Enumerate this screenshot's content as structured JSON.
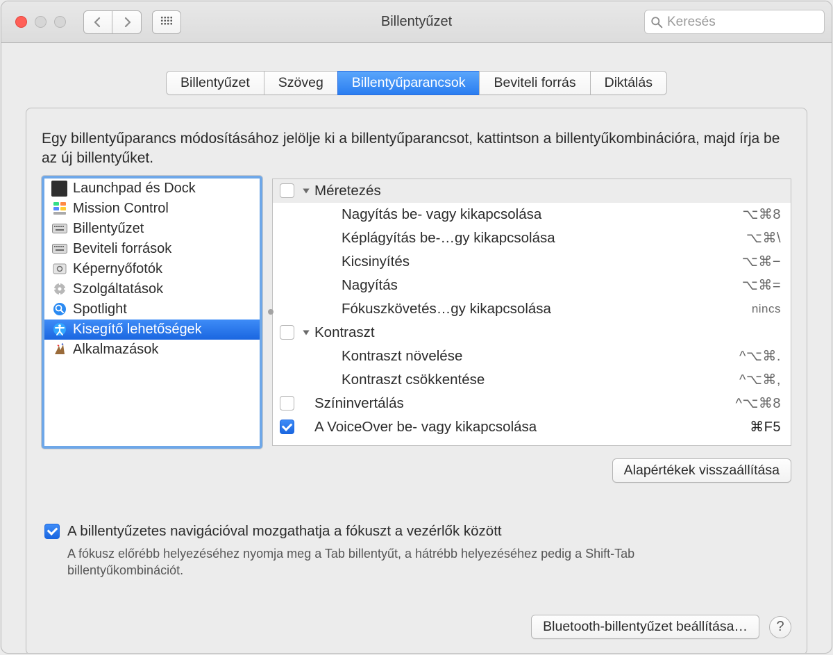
{
  "window_title": "Billentyűzet",
  "search": {
    "placeholder": "Keresés"
  },
  "tabs": [
    {
      "label": "Billentyűzet"
    },
    {
      "label": "Szöveg"
    },
    {
      "label": "Billentyűparancsok"
    },
    {
      "label": "Beviteli forrás"
    },
    {
      "label": "Diktálás"
    }
  ],
  "instruction": "Egy billentyűparancs módosításához jelölje ki a billentyűparancsot, kattintson a billentyűkombinációra, majd írja be az új billentyűket.",
  "sidebar": [
    {
      "label": "Launchpad és Dock",
      "icon": "launchpad-dock-icon"
    },
    {
      "label": "Mission Control",
      "icon": "mission-control-icon"
    },
    {
      "label": "Billentyűzet",
      "icon": "keyboard-icon"
    },
    {
      "label": "Beviteli források",
      "icon": "input-sources-icon"
    },
    {
      "label": "Képernyőfotók",
      "icon": "screenshots-icon"
    },
    {
      "label": "Szolgáltatások",
      "icon": "services-icon"
    },
    {
      "label": "Spotlight",
      "icon": "spotlight-icon"
    },
    {
      "label": "Kisegítő lehetőségek",
      "icon": "accessibility-icon"
    },
    {
      "label": "Alkalmazások",
      "icon": "applications-icon"
    }
  ],
  "shortcuts": {
    "group1": {
      "label": "Méretezés"
    },
    "zoom_toggle": {
      "label": "Nagyítás be- vagy kikapcsolása",
      "keys": "⌥⌘8"
    },
    "smooth_toggle": {
      "label": "Képlágyítás be-…gy kikapcsolása",
      "keys": "⌥⌘\\"
    },
    "zoom_out": {
      "label": "Kicsinyítés",
      "keys": "⌥⌘−"
    },
    "zoom_in": {
      "label": "Nagyítás",
      "keys": "⌥⌘="
    },
    "focus_follow": {
      "label": "Fókuszkövetés…gy kikapcsolása",
      "keys": "nincs"
    },
    "group2": {
      "label": "Kontraszt"
    },
    "contrast_up": {
      "label": "Kontraszt növelése",
      "keys": "^⌥⌘."
    },
    "contrast_down": {
      "label": "Kontraszt csökkentése",
      "keys": "^⌥⌘,"
    },
    "invert": {
      "label": "Színinvertálás",
      "keys": "^⌥⌘8"
    },
    "voiceover": {
      "label": "A VoiceOver be- vagy kikapcsolása",
      "keys": "⌘F5"
    }
  },
  "restore_defaults": "Alapértékek visszaállítása",
  "focus_nav": {
    "label": "A billentyűzetes navigációval mozgathatja a fókuszt a vezérlők között",
    "help": "A fókusz előrébb helyezéséhez nyomja meg a Tab billentyűt, a hátrébb helyezéséhez pedig a Shift-Tab billentyűkombinációt."
  },
  "bluetooth_button": "Bluetooth-billentyűzet beállítása…",
  "help_q": "?"
}
